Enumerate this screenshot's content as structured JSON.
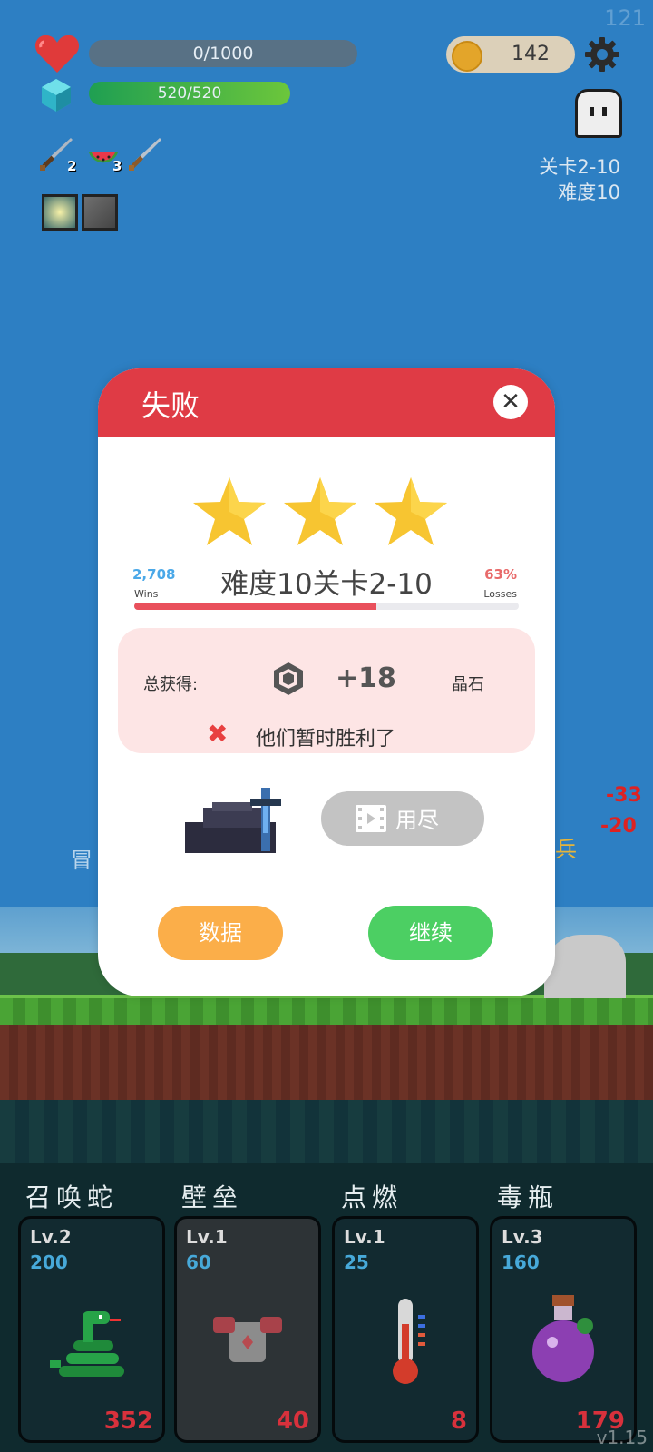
{
  "hud": {
    "fps": "121",
    "health_text": "0/1000",
    "health_fraction": 0.0,
    "mana_text": "520/520",
    "mana_fraction": 1.0,
    "coins": "142",
    "stage": "关卡2-10",
    "difficulty": "难度10",
    "items": [
      {
        "icon": "sword-icon",
        "count": "2"
      },
      {
        "icon": "watermelon-icon",
        "count": "3"
      },
      {
        "icon": "sword-icon",
        "count": ""
      }
    ],
    "skills": [
      {
        "icon": "light-skill-icon"
      },
      {
        "icon": "stone-skill-icon"
      }
    ]
  },
  "scene": {
    "damage_1": "-33",
    "damage_2": "-20",
    "partial_left": "冒",
    "partial_right": "兵"
  },
  "modal": {
    "title": "失败",
    "stars": 3,
    "level_title": "难度10关卡2-10",
    "wins_count": "2,708",
    "wins_label": "Wins",
    "loss_percent": "63%",
    "loss_label": "Losses",
    "progress_fraction": 0.63,
    "reward": {
      "label": "总获得:",
      "amount": "+18",
      "unit": "晶石",
      "message": "他们暂时胜利了"
    },
    "ad_label": "用尽",
    "data_button": "数据",
    "continue_button": "继续"
  },
  "cards": [
    {
      "title": "召唤蛇",
      "level": "Lv.2",
      "cost": "200",
      "number": "352",
      "icon": "snake-icon"
    },
    {
      "title": "壁垒",
      "level": "Lv.1",
      "cost": "60",
      "number": "40",
      "icon": "armor-icon"
    },
    {
      "title": "点燃",
      "level": "Lv.1",
      "cost": "25",
      "number": "8",
      "icon": "thermometer-icon"
    },
    {
      "title": "毒瓶",
      "level": "Lv.3",
      "cost": "160",
      "number": "179",
      "icon": "poison-bottle-icon"
    }
  ],
  "version": "v1.15",
  "colors": {
    "accent": "#df3b45",
    "data_button": "#fbae49",
    "continue_button": "#4ccf63",
    "sky": "#2d7fc3"
  }
}
